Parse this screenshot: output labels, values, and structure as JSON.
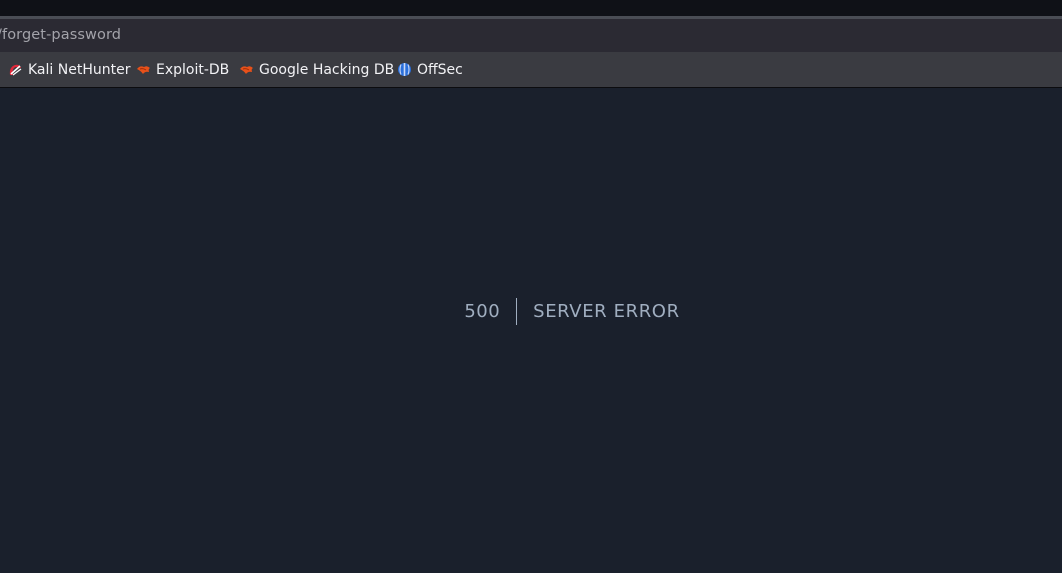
{
  "browser": {
    "url": "/forget-password",
    "bookmarks": [
      {
        "label": "Kali NetHunter",
        "icon": "kali-nethunter-icon"
      },
      {
        "label": "Exploit-DB",
        "icon": "exploit-db-icon"
      },
      {
        "label": "Google Hacking DB",
        "icon": "exploit-db-icon"
      },
      {
        "label": "OffSec",
        "icon": "offsec-icon"
      }
    ]
  },
  "error": {
    "code": "500",
    "message": "SERVER ERROR"
  },
  "colors": {
    "page_background": "#1a202c",
    "error_text": "#a0aec0",
    "bookmark_accent": "#e8511a"
  }
}
